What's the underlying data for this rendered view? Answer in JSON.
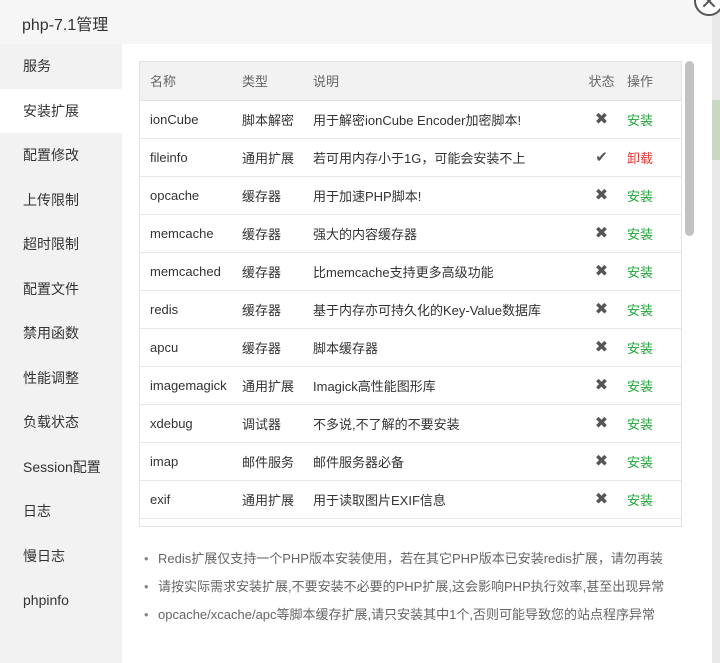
{
  "dialog": {
    "title": "php-7.1管理"
  },
  "sidebar": {
    "items": [
      {
        "label": "服务"
      },
      {
        "label": "安装扩展",
        "active": true
      },
      {
        "label": "配置修改"
      },
      {
        "label": "上传限制"
      },
      {
        "label": "超时限制"
      },
      {
        "label": "配置文件"
      },
      {
        "label": "禁用函数"
      },
      {
        "label": "性能调整"
      },
      {
        "label": "负载状态"
      },
      {
        "label": "Session配置"
      },
      {
        "label": "日志"
      },
      {
        "label": "慢日志"
      },
      {
        "label": "phpinfo"
      }
    ]
  },
  "table": {
    "headers": [
      "名称",
      "类型",
      "说明",
      "状态",
      "操作"
    ],
    "rows": [
      {
        "name": "ionCube",
        "type": "脚本解密",
        "desc": "用于解密ionCube Encoder加密脚本!",
        "status": "✖",
        "op": "安装"
      },
      {
        "name": "fileinfo",
        "type": "通用扩展",
        "desc": "若可用内存小于1G，可能会安装不上",
        "status": "✔",
        "op": "卸载"
      },
      {
        "name": "opcache",
        "type": "缓存器",
        "desc": "用于加速PHP脚本!",
        "status": "✖",
        "op": "安装"
      },
      {
        "name": "memcache",
        "type": "缓存器",
        "desc": "强大的内容缓存器",
        "status": "✖",
        "op": "安装"
      },
      {
        "name": "memcached",
        "type": "缓存器",
        "desc": "比memcache支持更多高级功能",
        "status": "✖",
        "op": "安装"
      },
      {
        "name": "redis",
        "type": "缓存器",
        "desc": "基于内存亦可持久化的Key-Value数据库",
        "status": "✖",
        "op": "安装"
      },
      {
        "name": "apcu",
        "type": "缓存器",
        "desc": "脚本缓存器",
        "status": "✖",
        "op": "安装"
      },
      {
        "name": "imagemagick",
        "type": "通用扩展",
        "desc": "Imagick高性能图形库",
        "status": "✖",
        "op": "安装"
      },
      {
        "name": "xdebug",
        "type": "调试器",
        "desc": "不多说,不了解的不要安装",
        "status": "✖",
        "op": "安装"
      },
      {
        "name": "imap",
        "type": "邮件服务",
        "desc": "邮件服务器必备",
        "status": "✖",
        "op": "安装"
      },
      {
        "name": "exif",
        "type": "通用扩展",
        "desc": "用于读取图片EXIF信息",
        "status": "✖",
        "op": "安装"
      }
    ]
  },
  "notes": [
    "Redis扩展仅支持一个PHP版本安装使用，若在其它PHP版本已安装redis扩展，请勿再装",
    "请按实际需求安装扩展,不要安装不必要的PHP扩展,这会影响PHP执行效率,甚至出现异常",
    "opcache/xcache/apc等脚本缓存扩展,请只安装其中1个,否则可能导致您的站点程序异常"
  ],
  "colors": {
    "install": "#20a53a",
    "uninstall": "#e53935"
  }
}
